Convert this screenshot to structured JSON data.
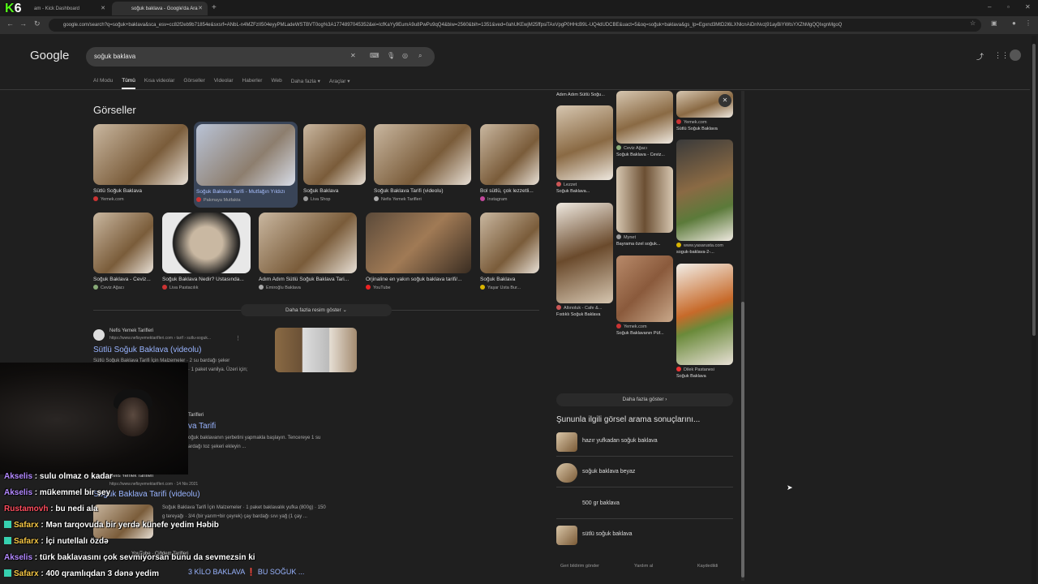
{
  "browser": {
    "tab1_title": "am - Kick Dashboard",
    "tab2_title": "soğuk baklava - Google'da Ara",
    "url": "google.com/search?q=soğuk+baklava&sca_esv=cc82f2eb9b71854e&sxsrf=ANbL-n4MZFzII504eyyPMLadeWSTBVT0og%3A1774897045352&ei=IcfKaYy9EumA9u8PwPu9qQ4&biw=2560&bih=1351&ved=0ahUKEwjM25ffpsiTAxVpgP0HHcB9L-UQ4dUDCBE&uact=5&oq=soğuk+baklava&gs_lp=Egxnd3MtD2l6LXNlcnAiDnNvzj91ayBiYWtsYXZhMgQQIxgnMgoQ"
  },
  "overlay": {
    "logo_k": "K",
    "logo_num": "6"
  },
  "google": {
    "logo": "Google",
    "query": "soğuk baklava",
    "tabs": [
      "AI Modu",
      "Tümü",
      "Kısa videolar",
      "Görseller",
      "Videolar",
      "Haberler",
      "Web",
      "Daha fazla ▾",
      "Araçlar ▾"
    ]
  },
  "images": {
    "heading": "Görseller",
    "row1": [
      {
        "title": "Sütlü Soğuk Baklava",
        "source": "Yemek.com"
      },
      {
        "title": "Soğuk Baklava Tarifi - Mutfağın Yıldızı",
        "source": "Pakmaya Mutfakta"
      },
      {
        "title": "Soğuk Baklava",
        "source": "Liva Shop"
      },
      {
        "title": "Soğuk Baklava Tarifi (videolu)",
        "source": "Nefis Yemek Tarifleri"
      },
      {
        "title": "Bol sütlü, çok lezzetli...",
        "source": "Instagram"
      }
    ],
    "row2": [
      {
        "title": "Soğuk Baklava - Ceviz...",
        "source": "Ceviz Ağacı"
      },
      {
        "title": "Soğuk Baklava Nedir? Ustasında...",
        "source": "Liva Pastacılık"
      },
      {
        "title": "Adım Adım Sütlü Soğuk Baklava Tari...",
        "source": "Emiroğlu Baklava"
      },
      {
        "title": "Orjinaline en yakın soğuk baklava tarifi/...",
        "source": "YouTube"
      },
      {
        "title": "Soğuk Baklava",
        "source": "Yaşar Usta Bur..."
      }
    ],
    "more": "Daha fazla resim göster ⌄"
  },
  "results": [
    {
      "site": "Nefis Yemek Tarifleri",
      "url": "https://www.nefisyemektarifleri.com › tarif › sutlu-soguk...",
      "title": "Sütlü Soğuk Baklava (videolu)",
      "snippet1": "Sütlü Soğuk Baklava Tarifi İçin Malzemeler · 2 su bardağı şeker",
      "snippet2": "· 1 paket vanilya. Üzeri için;"
    },
    {
      "site": "Tarifleri",
      "title": "va Tarifi",
      "snippet1": "oğuk baklavanın şerbetini yapmakla başlayın. Tencereye 1 su",
      "snippet2": "ardağı toz şekeri ekleyin ..."
    },
    {
      "site": "Nefis Yemek Tarifleri",
      "url": "https://www.nefisyemektarifleri.com · 14 Nis 2021",
      "title": "Soğuk Baklava Tarifi (videolu)",
      "snippet1": "Soğuk Baklava Tarifi İçin Malzemeler · 1 paket baklavalık yufka (800g) · 150",
      "snippet2": "g tereyağı · 3/4 (bir yarım+bir çeyrek) çay bardağı sıvı yağ (1 çay ..."
    },
    {
      "site": "YouTube · Çiğdem Tarifleri",
      "title": "3 KİLO BAKLAVA ❗ BU SOĞUK ..."
    }
  ],
  "right_panel": {
    "col1": [
      {
        "source": "Adım Adım Sütlü Soğu...",
        "caption": ""
      },
      {
        "source": "Lezzet",
        "caption": "Soğuk Baklava..."
      },
      {
        "source": "Altınoluk - Cafe &...",
        "caption": "Fıstıklı Soğuk Baklava"
      }
    ],
    "col2": [
      {
        "source": "Ceviz Ağacı",
        "caption": "Soğuk Baklava - Ceviz..."
      },
      {
        "source": "Mynet",
        "caption": "Bayrama özel soğuk..."
      },
      {
        "source": "Yemek.com",
        "caption": "Soğuk Baklavanın Püf..."
      }
    ],
    "col3": [
      {
        "source": "Yemek.com",
        "caption": "Sütlü Soğuk Baklava"
      },
      {
        "source": "www.yasarusta.com",
        "caption": "soguk-baklava-2-..."
      },
      {
        "source": "Dilek Pastanesi",
        "caption": "Soğuk Baklava"
      }
    ],
    "more": "Daha fazla göster ›",
    "related_heading": "Şununla ilgili görsel arama sonuçlarını...",
    "related": [
      "hazır yufkadan soğuk baklava",
      "soğuk baklava beyaz",
      "500 gr baklava",
      "sütlü soğuk baklava"
    ],
    "footer": [
      "Geri bildirim gönder",
      "Yardım al",
      "Kaydedildi"
    ]
  },
  "chat": [
    {
      "user": "Akselis",
      "text": " : sulu olmaz o kadar",
      "color": "#b388ff"
    },
    {
      "user": "Akselis",
      "text": " : mükemmel bir şey",
      "color": "#b388ff"
    },
    {
      "user": "Rustamovh",
      "text": " : bu nedi ala",
      "color": "#ff4d5e"
    },
    {
      "user": "Safarx",
      "text": " : Mən tarqovuda bir yerdə künefe yedim Həbib",
      "color": "#f7c744"
    },
    {
      "user": "Safarx",
      "text": " : İçi nutellalı özdə",
      "color": "#f7c744"
    },
    {
      "user": "Akselis",
      "text": " : türk baklavasını çok sevmiyorsan bunu da sevmezsin ki",
      "color": "#b388ff"
    },
    {
      "user": "Safarx",
      "text": " : 400 qramlıqdan 3 dənə yedim",
      "color": "#f7c744"
    }
  ]
}
